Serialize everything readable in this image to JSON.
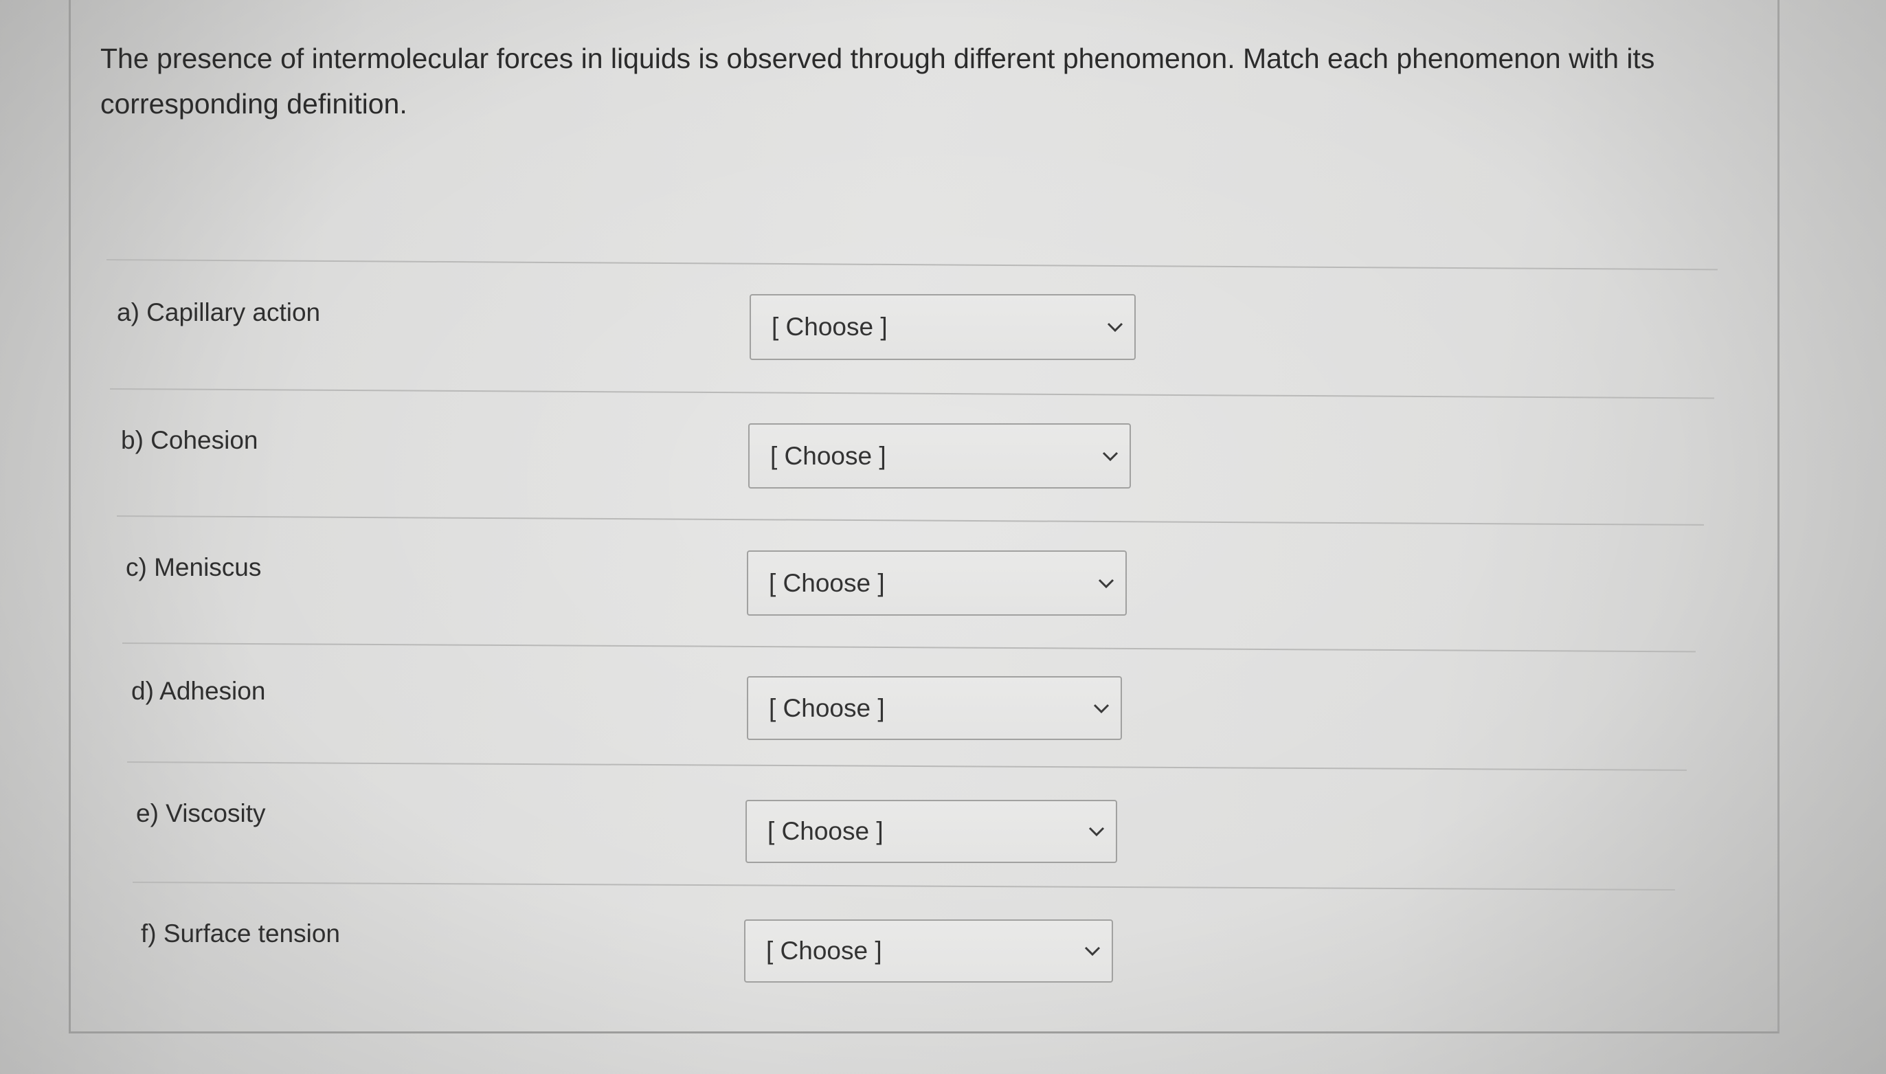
{
  "question": {
    "text": "The presence of intermolecular forces in liquids is observed through different phenomenon. Match each phenomenon with its corresponding definition."
  },
  "rows": [
    {
      "label": "a) Capillary action",
      "select_value": "[ Choose ]"
    },
    {
      "label": "b) Cohesion",
      "select_value": "[ Choose ]"
    },
    {
      "label": "c) Meniscus",
      "select_value": "[ Choose ]"
    },
    {
      "label": "d) Adhesion",
      "select_value": "[ Choose ]"
    },
    {
      "label": "e) Viscosity",
      "select_value": "[ Choose ]"
    },
    {
      "label": "f) Surface tension",
      "select_value": "[ Choose ]"
    }
  ],
  "icons": {
    "dropdown": "chevron-down-icon"
  }
}
